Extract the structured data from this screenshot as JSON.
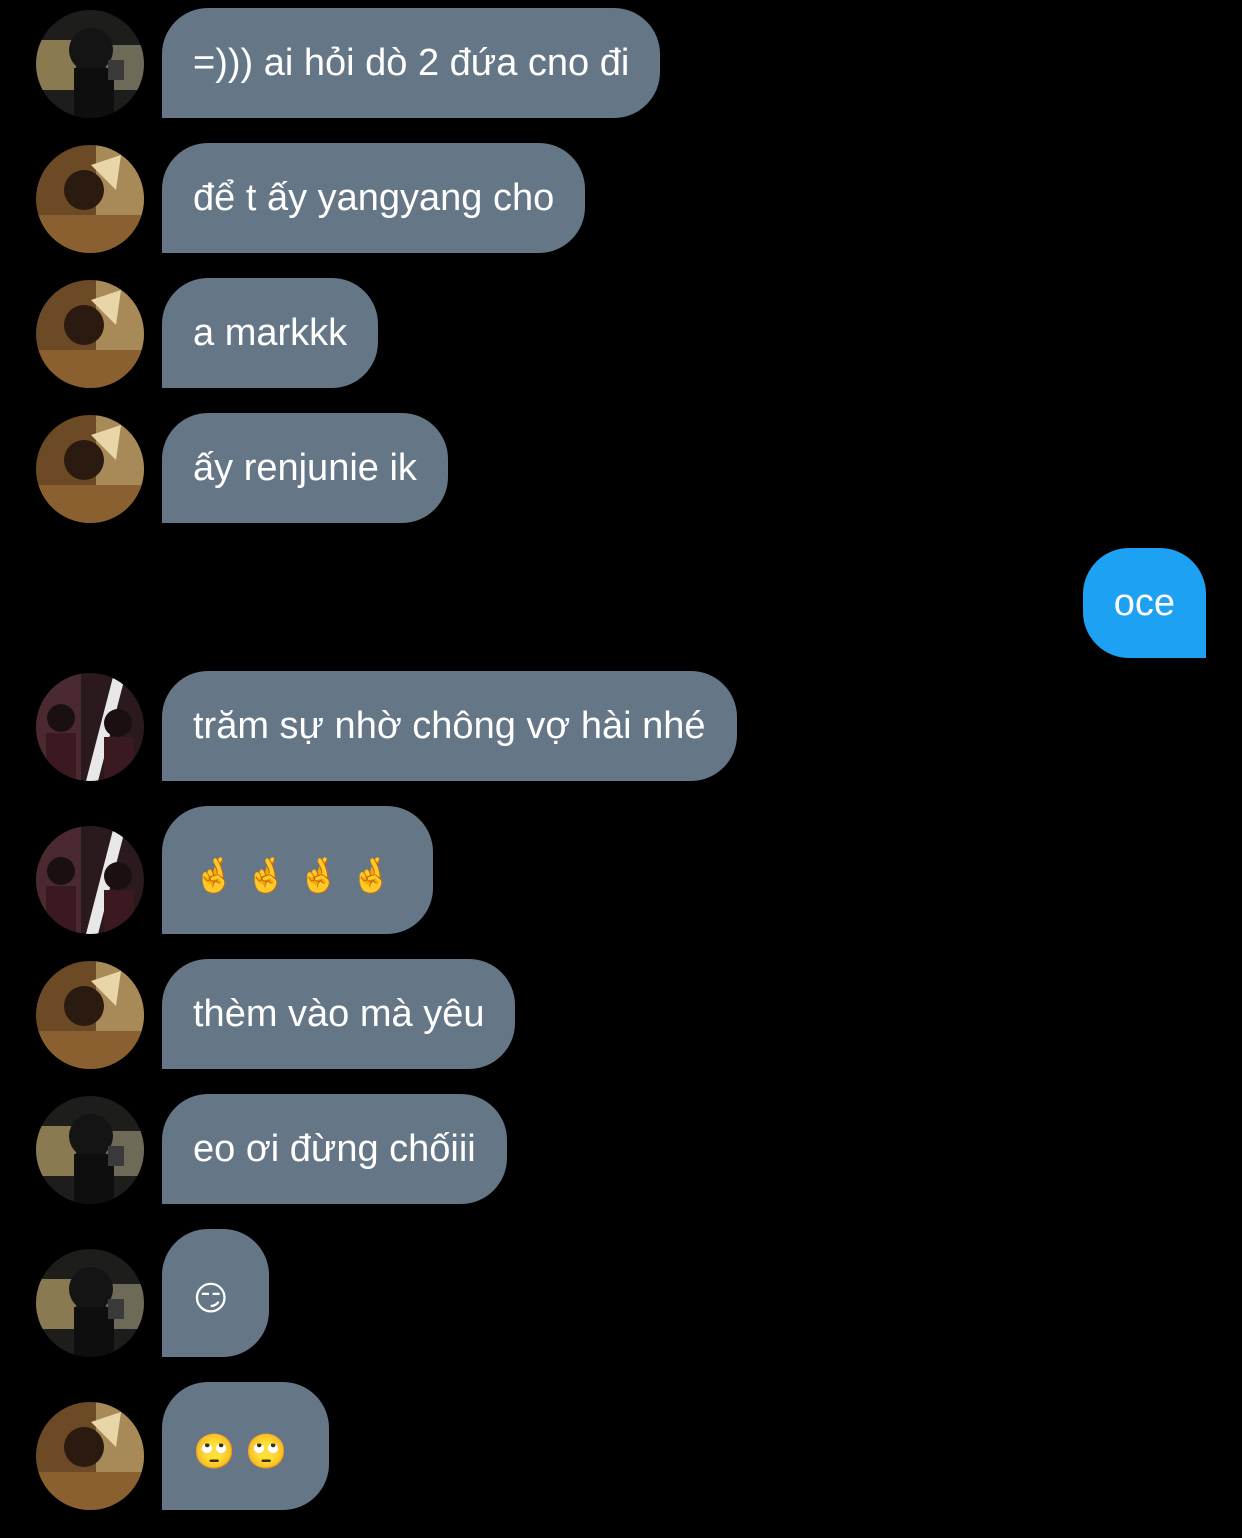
{
  "colors": {
    "background": "#000000",
    "incoming_bubble": "#657786",
    "outgoing_bubble": "#1da1f2",
    "text": "#ffffff"
  },
  "messages": [
    {
      "side": "in",
      "avatar": "avatar-a",
      "text": "=))) ai hỏi dò 2 đứa cno đi"
    },
    {
      "side": "in",
      "avatar": "avatar-b",
      "text": "để t ấy yangyang cho"
    },
    {
      "side": "in",
      "avatar": "avatar-b",
      "text": "a markkk"
    },
    {
      "side": "in",
      "avatar": "avatar-b",
      "text": "ấy renjunie ik"
    },
    {
      "side": "out",
      "text": "oce"
    },
    {
      "side": "in",
      "avatar": "avatar-c",
      "text": "trăm sự nhờ chông vợ hài nhé"
    },
    {
      "side": "in",
      "avatar": "avatar-c",
      "text": "🤞🤞🤞🤞"
    },
    {
      "side": "in",
      "avatar": "avatar-b",
      "text": "thèm vào mà yêu"
    },
    {
      "side": "in",
      "avatar": "avatar-a",
      "text": "eo ơi đừng chốiii"
    },
    {
      "side": "in",
      "avatar": "avatar-a",
      "text": "😏"
    },
    {
      "side": "in",
      "avatar": "avatar-b",
      "text": "🙄🙄"
    }
  ]
}
